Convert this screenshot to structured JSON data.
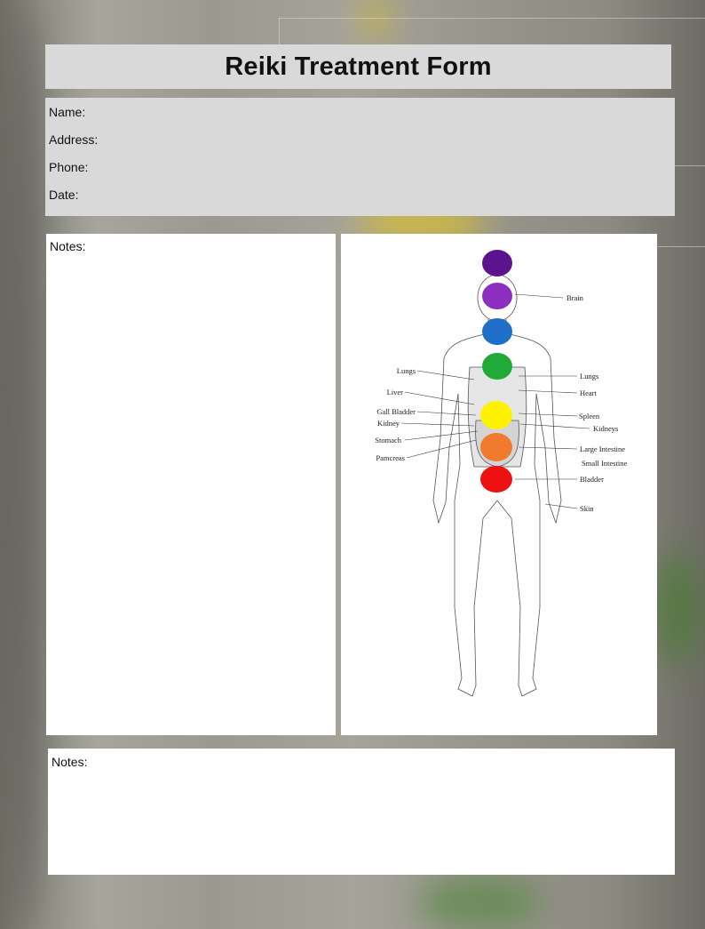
{
  "form": {
    "title": "Reiki Treatment Form",
    "fields": {
      "name": "Name:",
      "address": "Address:",
      "phone": "Phone:",
      "date": "Date:"
    },
    "notes_left_label": "Notes:",
    "notes_bottom_label": "Notes:"
  },
  "diagram": {
    "labels_left": [
      "Lungs",
      "Liver",
      "Gall Bladder",
      "Kidney",
      "Stomach",
      "Pamcreas"
    ],
    "labels_right": [
      "Brain",
      "Lungs",
      "Heart",
      "Spleen",
      "Kidneys",
      "Large Intestine",
      "Small Intestine",
      "Bladder",
      "Skin"
    ],
    "chakra_colors": [
      "#5b138f",
      "#8a2fc0",
      "#1e6fc8",
      "#1faa3a",
      "#fff200",
      "#f07a2e",
      "#ee1111"
    ]
  }
}
